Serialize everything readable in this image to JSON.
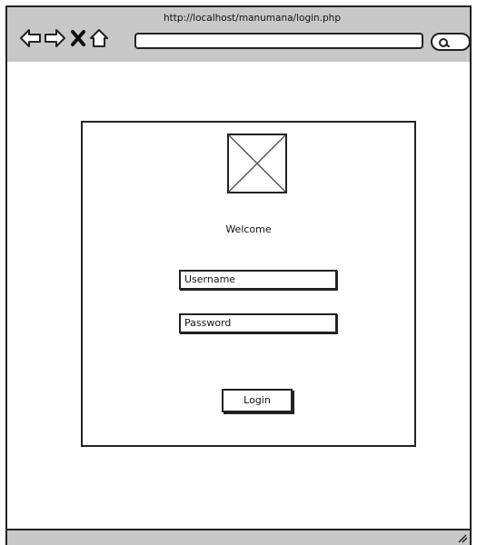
{
  "browser": {
    "url": "http://localhost/manumana/login.php",
    "address_value": ""
  },
  "login": {
    "welcome": "Welcome",
    "username_placeholder": "Username",
    "password_placeholder": "Password",
    "login_label": "Login"
  },
  "icons": {
    "back": "back-arrow-icon",
    "forward": "forward-arrow-icon",
    "stop": "close-icon",
    "home": "home-icon",
    "search": "search-icon",
    "logo": "image-placeholder-icon",
    "grip": "resize-grip-icon"
  },
  "colors": {
    "chrome": "#c8c8c8",
    "stroke": "#222222",
    "page": "#ffffff"
  }
}
